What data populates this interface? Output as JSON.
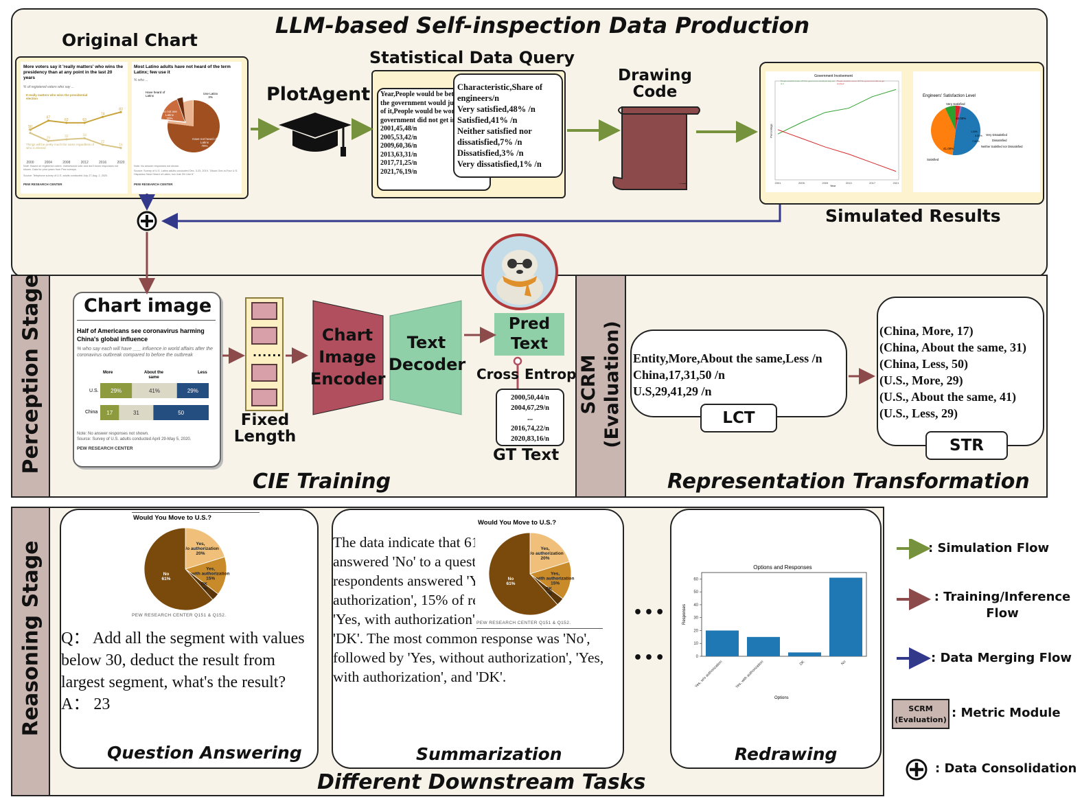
{
  "top": {
    "title": "LLM-based Self-inspection Data Production",
    "original_chart_label": "Original Chart",
    "plotagent_label": "PlotAgent",
    "statistical_query_label": "Statistical Data Query",
    "drawing_code_label": "Drawing\nCode",
    "simulated_results_label": "Simulated Results",
    "chart1": {
      "title": "More voters say it 'really matters' who wins the presidency than at any point in the last 20 years",
      "subtitle": "% of registered voters who say ...",
      "series1_label": "It really matters who wins the presidential election",
      "series2_label": "Things will be pretty much the same regardless of who is elected",
      "years": [
        "2000",
        "2004",
        "2008",
        "2012",
        "2016",
        "2020"
      ],
      "series1_values": [
        50,
        67,
        63,
        63,
        74,
        83
      ],
      "series2_values": [
        44,
        29,
        32,
        34,
        22,
        16
      ],
      "note": "Note: Based on registered voters. Voted/would vote and don't know responses not shown. Data for prior years from Pew surveys.",
      "source": "Source: Telephone survey of U.S. adults conducted July 27-Aug. 2, 2020.",
      "footer": "PEW RESEARCH CENTER"
    },
    "chart2": {
      "title": "Most Latino adults have not heard of the term Latinx; few use it",
      "subtitle": "% who ...",
      "slices": [
        {
          "label": "Have not heard of Latinx",
          "value": 76,
          "pct": "76%"
        },
        {
          "label": "Have heard of Latinx",
          "value": 23,
          "pct": ""
        },
        {
          "label": "Do not use Latinx",
          "value": 20,
          "pct": "20%"
        },
        {
          "label": "Use Latinx",
          "value": 3,
          "pct": "3%"
        }
      ],
      "note": "Note: No answer responses not shown.",
      "source": "Source: Survey of U.S. Latino adults conducted Dec. 3-23, 2019. \"About One-in-Four U.S. Hispanics Have Heard of Latinx, but Just 3% Use It\"",
      "footer": "PEW RESEARCH CENTER"
    },
    "query_back": "Year,People would be better off if the government would just stay out of it,People would be worse off if the government did not get involved/n\n2001,45,48/n\n2005,53,42/n\n2009,60,36/n\n2013,63,31/n\n2017,71,25/n\n2021,76,19/n",
    "query_front": "Characteristic,Share of engineers/n\nVery satisfied,48% /n\nSatisfied,41% /n\nNeither satisfied nor dissatisfied,7% /n\nDissatisfied,3% /n\nVery dissatisfied,1% /n",
    "sim_line": {
      "title": "Government Involvement",
      "legend1": "People would be better off if the government would just stay out of it",
      "legend2": "People would be worse off if the government did not get involved",
      "years": [
        "2001",
        "2005",
        "2009",
        "2013",
        "2017",
        "2021"
      ],
      "up": [
        45,
        53,
        60,
        63,
        71,
        76
      ],
      "down": [
        48,
        42,
        36,
        31,
        25,
        19
      ],
      "xlabel": "Year",
      "ylabel": "Percentage"
    },
    "sim_pie": {
      "title": "Engineers' Satisfaction Level",
      "slices": [
        {
          "label": "Very Satisfied",
          "value": 48,
          "pct": "48.00%",
          "color": "#1f77b4"
        },
        {
          "label": "Satisfied",
          "value": 41,
          "pct": "41.00%",
          "color": "#ff7f0e"
        },
        {
          "label": "Neither Satisfied nor Dissatisfied",
          "value": 7,
          "pct": "7.00%",
          "color": "#2ca02c"
        },
        {
          "label": "Dissatisfied",
          "value": 3,
          "pct": "3.00%",
          "color": "#d62728"
        },
        {
          "label": "Very Dissatisfied",
          "value": 1,
          "pct": "1.00%",
          "color": "#9467bd"
        }
      ]
    }
  },
  "perception": {
    "stage_label": "Perception Stage",
    "chart_image_label": "Chart image",
    "chart": {
      "title": "Half of Americans see coronavirus harming China's global influence",
      "subtitle": "% who say each will have ___ influence in world affairs after the coronavirus outbreak compared to before the outbreak",
      "headers": [
        "More",
        "About the same",
        "Less"
      ],
      "rows": [
        {
          "name": "U.S.",
          "values": [
            29,
            41,
            29
          ],
          "labels": [
            "29%",
            "41%",
            "29%"
          ]
        },
        {
          "name": "China",
          "values": [
            17,
            31,
            50
          ],
          "labels": [
            "17",
            "31",
            "50"
          ]
        }
      ],
      "colors": [
        "#8d9a3d",
        "#dcd8c6",
        "#244d80"
      ],
      "note": "Note: No answer responses not shown.",
      "source": "Source: Survey of U.S. adults conducted April 29-May 5, 2020.",
      "footer": "PEW RESEARCH CENTER"
    },
    "dots": "......",
    "fixed_length_label": "Fixed\nLength",
    "encoder_label": "Chart\nImage\nEncoder",
    "decoder_label": "Text\nDecoder",
    "pred_text_label": "Pred\nText",
    "cross_label": "Cross",
    "entropy_label": "Entropy",
    "gt_text": "2000,50,44/n\n2004,67,29/n\n...\n2016,74,22/n\n2020,83,16/n",
    "gt_label": "GT Text",
    "section_title": "CIE Training"
  },
  "scrm": {
    "label": "SCRM\n(Evaluation)",
    "lct_text": "Entity,More,About the same,Less /n\nChina,17,31,50 /n\nU.S,29,41,29 /n",
    "lct_label": "LCT",
    "str_text": "(China, More, 17)\n(China, About the same, 31)\n(China, Less, 50)\n(U.S., More, 29)\n(U.S., About the same, 41)\n(U.S., Less, 29)",
    "str_label": "STR",
    "section_title": "Representation Transformation"
  },
  "reasoning": {
    "stage_label": "Reasoning Stage",
    "pie": {
      "title": "Would You Move to U.S.?",
      "slices": [
        {
          "label": "No",
          "pct": "61%",
          "value": 61,
          "color": "#7a4a0c"
        },
        {
          "label": "Yes, w/o authorization",
          "pct": "20%",
          "value": 20,
          "color": "#f0c07a"
        },
        {
          "label": "Yes, with authorization",
          "pct": "15%",
          "value": 15,
          "color": "#c98a2a"
        },
        {
          "label": "DK",
          "pct": "3%",
          "value": 3,
          "color": "#5a3508"
        }
      ],
      "footer": "PEW RESEARCH CENTER Q151 & Q152."
    },
    "qa_text": "Q： Add all the segment with values below 30, deduct the result from largest segment, what's the result?\nA： 23",
    "qa_title": "Question Answering",
    "summary_text": "The data indicate that 61% of respondents answered 'No' to a question, 20% of respondents answered 'Yes, without authorization', 15% of respondents answered 'Yes, with authorization', and 3% answered 'DK'. The most common response was 'No', followed by 'Yes, without authorization', 'Yes, with authorization', and 'DK'.",
    "summary_title": "Summarization",
    "ellipsis": "•••",
    "redraw": {
      "title": "Options and Responses",
      "categories": [
        "Yes, w/o authorization",
        "Yes, with authorization",
        "DK",
        "No"
      ],
      "values": [
        20,
        15,
        3,
        61
      ],
      "yticks": [
        "0",
        "10",
        "20",
        "30",
        "40",
        "50",
        "60"
      ],
      "xlabel": "Options",
      "ylabel": "Responses",
      "color": "#1f77b4"
    },
    "redraw_title": "Redrawing",
    "section_title": "Different Downstream Tasks"
  },
  "legend": {
    "simulation": ": Simulation Flow",
    "training": ": Training/Inference\nFlow",
    "merging": ": Data Merging Flow",
    "metric_box": "SCRM\n(Evaluation)",
    "metric": ": Metric Module",
    "consolidation": ": Data Consolidation"
  },
  "colors": {
    "simulation": "#76923c",
    "training": "#8c4a4a",
    "merging": "#33398a",
    "encoder": "#b24f5e",
    "decoder": "#8fd0a8",
    "pred": "#8fd0a8",
    "panel": "#f7f3e9",
    "sidebar": "#c9b6b0",
    "scroll": "#8c4a4a"
  }
}
